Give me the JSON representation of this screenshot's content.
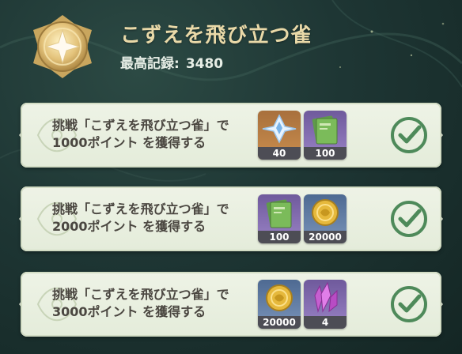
{
  "event": {
    "title": "こずえを飛び立つ雀",
    "record_label": "最高記録:",
    "record_value": "3480",
    "medal_icon": "gold-star-medal-icon"
  },
  "challenges": [
    {
      "line1": "挑戦「こずえを飛び立つ雀」で",
      "line2": "1000ポイント を獲得する",
      "completed": true,
      "rewards": [
        {
          "icon": "primogem-icon",
          "quantity": "40"
        },
        {
          "icon": "heros-wit-book-icon",
          "quantity": "100"
        }
      ]
    },
    {
      "line1": "挑戦「こずえを飛び立つ雀」で",
      "line2": "2000ポイント を獲得する",
      "completed": true,
      "rewards": [
        {
          "icon": "heros-wit-book-icon",
          "quantity": "100"
        },
        {
          "icon": "mora-coin-icon",
          "quantity": "20000"
        }
      ]
    },
    {
      "line1": "挑戦「こずえを飛び立つ雀」で",
      "line2": "3000ポイント を獲得する",
      "completed": true,
      "rewards": [
        {
          "icon": "mora-coin-icon",
          "quantity": "20000"
        },
        {
          "icon": "purple-crystal-icon",
          "quantity": "4"
        }
      ]
    }
  ],
  "colors": {
    "title_gold": "#e9d9a8",
    "card_bg": "#e4ecda",
    "check_green": "#4e8a5a",
    "quantity_bar": "#4d4d55"
  }
}
